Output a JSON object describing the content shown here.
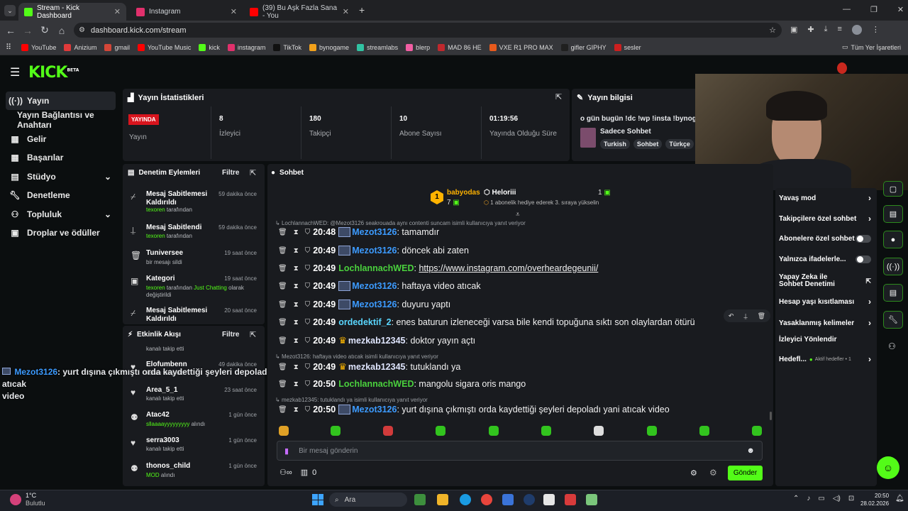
{
  "browser": {
    "tabs": [
      {
        "title": "Stream - Kick Dashboard",
        "icon": "kick-icon",
        "color": "#53fc18"
      },
      {
        "title": "Instagram",
        "icon": "instagram-icon",
        "color": "#e1306c"
      },
      {
        "title": "(39) Bu Aşk Fazla Sana - You",
        "icon": "youtube-icon",
        "color": "#ff0000"
      }
    ],
    "url": "dashboard.kick.com/stream",
    "bookmarks": [
      {
        "label": "YouTube",
        "color": "#ff0000"
      },
      {
        "label": "Anizium",
        "color": "#e03a3a"
      },
      {
        "label": "gmail",
        "color": "#d44638"
      },
      {
        "label": "YouTube Music",
        "color": "#ff0000"
      },
      {
        "label": "kick",
        "color": "#53fc18"
      },
      {
        "label": "instagram",
        "color": "#e1306c"
      },
      {
        "label": "TikTok",
        "color": "#111111"
      },
      {
        "label": "bynogame",
        "color": "#f2a11a"
      },
      {
        "label": "streamlabs",
        "color": "#31c3a2"
      },
      {
        "label": "blerp",
        "color": "#f25ea3"
      },
      {
        "label": "MAD 86 HE",
        "color": "#c0282d"
      },
      {
        "label": "VXE R1 PRO MAX",
        "color": "#e85a1c"
      },
      {
        "label": "gifler GIPHY",
        "color": "#202020"
      },
      {
        "label": "sesler",
        "color": "#cc1f1f"
      }
    ],
    "all_bookmarks": "Tüm Yer İşaretleri"
  },
  "kick": {
    "logo": "KICK",
    "logo_sup": "BETA",
    "accent": "#53fc18"
  },
  "sidebar": {
    "items": [
      {
        "label": "Yayın",
        "icon": "broadcast-icon"
      },
      {
        "label": "Yayın Bağlantısı ve Anahtarı"
      },
      {
        "label": "Gelir",
        "icon": "revenue-icon"
      },
      {
        "label": "Başarılar",
        "icon": "achievements-icon"
      },
      {
        "label": "Stüdyo",
        "icon": "studio-icon"
      },
      {
        "label": "Denetleme",
        "icon": "wrench-icon"
      },
      {
        "label": "Topluluk",
        "icon": "community-icon"
      },
      {
        "label": "Droplar ve ödüller",
        "icon": "drops-icon"
      }
    ]
  },
  "stats": {
    "title": "Yayın İstatistikleri",
    "live_badge": "YAYINDA",
    "live_label": "Yayın",
    "items": [
      {
        "value": "8",
        "label": "İzleyici"
      },
      {
        "value": "180",
        "label": "Takipçi"
      },
      {
        "value": "10",
        "label": "Abone Sayısı"
      },
      {
        "value": "01:19:56",
        "label": "Yayında Olduğu Süre"
      }
    ]
  },
  "stream_info": {
    "title": "Yayın bilgisi",
    "stream_title": "o gün bugün !dc !wp !insta !bynogan",
    "category": "Sadece Sohbet",
    "tags": [
      "Turkish",
      "Sohbet",
      "Türkçe"
    ]
  },
  "moderation": {
    "title": "Denetim Eylemleri",
    "filter": "Filtre",
    "items": [
      {
        "title": "Mesaj Sabitlemesi Kaldırıldı",
        "user": "texoren",
        "suffix": " tarafından",
        "when": "59 dakika önce"
      },
      {
        "title": "Mesaj Sabitlendi",
        "user": "texoren",
        "suffix": " tarafından",
        "when": "59 dakika önce"
      },
      {
        "title": "Tuniversee",
        "sub": "bir mesajı sildi",
        "when": "19 saat önce"
      },
      {
        "title": "Kategori",
        "user": "texoren",
        "suffix": " tarafından ",
        "extra": "Just Chatting",
        "extra2": " olarak",
        "line2": "değiştirildi",
        "when": "19 saat önce"
      },
      {
        "title": "Mesaj Sabitlemesi Kaldırıldı",
        "when": "20 saat önce"
      }
    ]
  },
  "activity": {
    "title": "Etkinlik Akışı",
    "filter": "Filtre",
    "top_sub": "kanalı takip etti",
    "items": [
      {
        "name": "Elofumbenn",
        "sub": "kanalı takip etti",
        "when": "49 dakika önce"
      },
      {
        "name": "Area_5_1",
        "sub": "kanalı takip etti",
        "when": "23 saat önce"
      },
      {
        "name": "Atac42",
        "sub_green": "sllaaaayyyyyyyyy",
        "sub": " alındı",
        "when": "1 gün önce"
      },
      {
        "name": "serra3003",
        "sub": "kanalı takip etti",
        "when": "1 gün önce"
      },
      {
        "name": "thonos_child",
        "sub_green": "MOD",
        "sub": " alındı",
        "when": "1 gün önce"
      }
    ]
  },
  "overlay": {
    "user": "Mezot3126",
    "message": ": yurt dışına çıkmıştı orda kaydettiği şeyleri depoladı yani atıcak",
    "message2": "video"
  },
  "chat": {
    "title": "Sohbet",
    "leaders": {
      "first_rank": "1",
      "first_name": "babyodas",
      "first_count": "7",
      "second_name": "Heloriii",
      "second_count": "1",
      "second_sub": "1 abonelik hediye ederek 3. sıraya yükselin"
    },
    "reply_top": "LochlannachWED: @Mezot3126 seakrouada aynı contenti suncam isimli kullanıcıya yanıt veriyor",
    "messages": [
      {
        "time": "20:48",
        "user": "Mezot3126",
        "text": ": tamamdır",
        "style": "blue",
        "badge": "avatar"
      },
      {
        "time": "20:49",
        "user": "Mezot3126",
        "text": ": döncek abi zaten",
        "style": "blue",
        "badge": "avatar"
      },
      {
        "time": "20:49",
        "user": "LochlannachWED",
        "text": ": ",
        "link": "https://www.instagram.com/overheardegeunii/",
        "style": "green",
        "badge": "none"
      },
      {
        "time": "20:49",
        "user": "Mezot3126",
        "text": ": haftaya video atıcak",
        "style": "blue",
        "badge": "avatar"
      },
      {
        "time": "20:49",
        "user": "Mezot3126",
        "text": ": duyuru yaptı",
        "style": "blue",
        "badge": "avatar"
      },
      {
        "time": "20:49",
        "user": "ordedektif_2",
        "text": ": enes baturun izleneceği varsa bile kendi topuğuna sıktı son olaylardan ötürü",
        "style": "cyan",
        "badge": "none"
      },
      {
        "time": "20:49",
        "user": "mezkab12345",
        "text": ": doktor yayın açtı",
        "style": "white",
        "badge": "crown"
      },
      {
        "time": "20:49",
        "user": "mezkab12345",
        "text": ": tutuklandı ya",
        "style": "white",
        "badge": "crown"
      },
      {
        "time": "20:50",
        "user": "LochlannachWED",
        "text": ": mangolu sigara oris mango",
        "style": "green",
        "badge": "none"
      },
      {
        "time": "20:50",
        "user": "Mezot3126",
        "text": ": yurt dışına çıkmıştı orda kaydettiği şeyleri depoladı yani atıcak video",
        "style": "blue",
        "badge": "avatar"
      }
    ],
    "reply_a": "Mezot3126: haftaya video atıcak isimli kullanıcıya yanıt veriyor",
    "reply_b": "mezkab12345: tutuklandı ya isimli kullanıcıya yanıt veriyor",
    "input_placeholder": "Bir mesaj gönderin",
    "points": "0",
    "send": "Gönder"
  },
  "chat_settings": {
    "items": [
      {
        "label": "Yavaş mod",
        "control": "arrow"
      },
      {
        "label": "Takipçilere özel sohbet",
        "control": "arrow"
      },
      {
        "label": "Abonelere özel sohbet",
        "control": "toggle"
      },
      {
        "label": "Yalnızca ifadelerle...",
        "control": "toggle"
      },
      {
        "label": "Yapay Zeka ile Sohbet Denetimi",
        "control": "external"
      },
      {
        "label": "Hesap yaşı kısıtlaması",
        "control": "arrow"
      },
      {
        "label": "Yasaklanmış kelimeler",
        "control": "arrow"
      },
      {
        "label": "İzleyici Yönlendir",
        "control": "none"
      },
      {
        "label": "Hedefl...",
        "extra": "Aktif hedefler • 1",
        "control": "arrow"
      }
    ]
  },
  "taskbar": {
    "weather_temp": "1°C",
    "weather_desc": "Bulutlu",
    "search": "Ara",
    "time": "20:50",
    "date": "28.02.2026"
  }
}
